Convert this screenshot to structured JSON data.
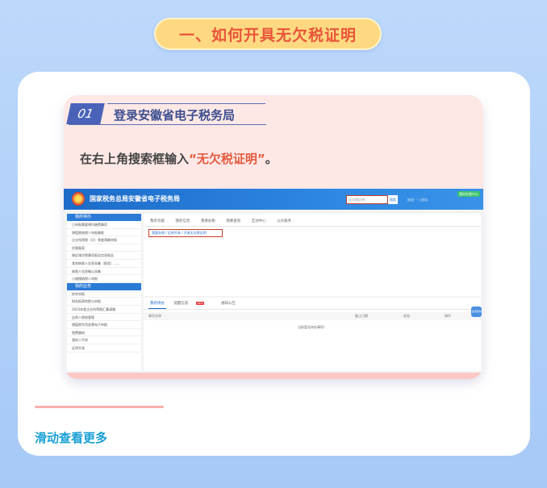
{
  "title": "一、如何开具无欠税证明",
  "step": {
    "number": "01",
    "title": "登录安徽省电子税务局"
  },
  "instruction": {
    "prefix": "在右上角搜索框输入",
    "highlight": "“无欠税证明”",
    "suffix": "。"
  },
  "screenshot": {
    "site_title": "国家税务总局安徽省电子税务局",
    "search_placeholder": "无欠税证明",
    "search_button": "搜索",
    "login_button": "我的办税中心",
    "user_text": "欢迎 ··· | 退出",
    "sidebar": {
      "section1": "我的待办",
      "items1": [
        "已申报需要预约缴费事项",
        "增值税纳税人申报缴款",
        "企业所得税（月）季度预缴申报",
        "优惠备案",
        "跨区域涉税事项报告信息报告",
        "其他纳税人信息采集（报验）……",
        "纳税人信息确认采集",
        "小规模纳税人申报"
      ],
      "section2": "我的业务",
      "items2": [
        "综合申报",
        "财务报表转换与申报",
        "2023年度企业所得税汇算清缴",
        "自然人税收管理",
        "增值税专用发票电子申报",
        "税费缴纳",
        "我的二手房",
        "证明开具"
      ]
    },
    "tabs": [
      "我的功能",
      "我的信息",
      "我要办税",
      "我要查询",
      "互动中心",
      "公众服务"
    ],
    "breadcrumb": "我要办税 / 证明开具 / 开具无欠税证明",
    "bottom_tabs": [
      "我的待办",
      "提醒信息",
      "通知公告"
    ],
    "badge": "NEW",
    "table_headers": [
      "事项名称",
      "截止日期",
      "状态",
      "操作"
    ],
    "empty_text": "当前暂无待办事项！",
    "float_button": "在线咨询"
  },
  "footer_link": "滑动查看更多"
}
